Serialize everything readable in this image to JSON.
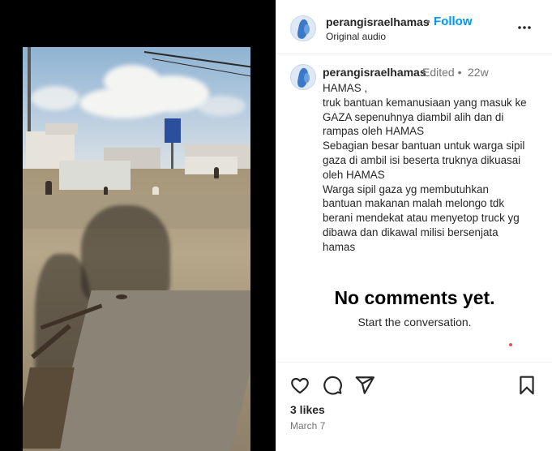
{
  "post": {
    "username": "perangisraelhamas",
    "separator": "•",
    "follow_label": "Follow",
    "audio_label": "Original audio",
    "more_icon": "more-horizontal-icon"
  },
  "caption": {
    "username": "perangisraelhamas",
    "edited_label": "Edited •",
    "timestamp": "22w",
    "lines": [
      "HAMAS ,",
      "truk bantuan kemanusiaan yang masuk ke",
      "GAZA sepenuhnya diambil alih dan di",
      "rampas oleh HAMAS",
      "Sebagian besar bantuan untuk warga sipil",
      "gaza di ambil isi beserta truknya dikuasai",
      "oleh HAMAS",
      "Warga sipil gaza yg membutuhkan",
      "bantuan makanan malah melongo tdk",
      "berani mendekat atau menyetop truck yg",
      "dibawa dan dikawal milisi bersenjata",
      "hamas"
    ]
  },
  "comments": {
    "empty_title": "No comments yet.",
    "empty_subtitle": "Start the conversation."
  },
  "actions": {
    "icons": [
      "heart-icon",
      "comment-icon",
      "share-icon",
      "bookmark-icon"
    ],
    "likes": "3 likes",
    "date": "March 7"
  },
  "colors": {
    "accent": "#0095f6",
    "text": "#262626",
    "secondary": "#737373",
    "notification": "#ed4956"
  }
}
